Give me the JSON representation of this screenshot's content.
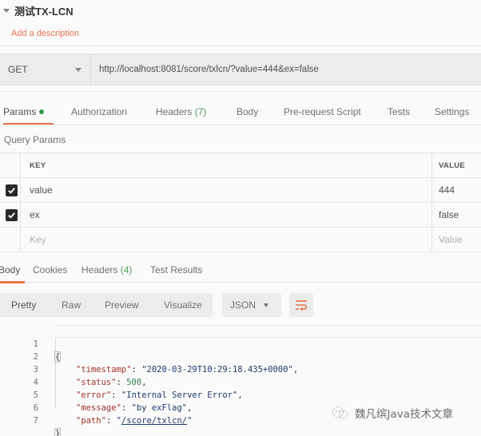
{
  "request": {
    "name": "测试TX-LCN",
    "add_description": "Add a description",
    "method": "GET",
    "url": "http://localhost:8081/score/txlcn/?value=444&ex=false"
  },
  "request_tabs": [
    {
      "label": "Params",
      "active": true,
      "indicator": "green-dot"
    },
    {
      "label": "Authorization"
    },
    {
      "label": "Headers",
      "count": "(7)"
    },
    {
      "label": "Body"
    },
    {
      "label": "Pre-request Script"
    },
    {
      "label": "Tests"
    },
    {
      "label": "Settings"
    }
  ],
  "query_params": {
    "title": "Query Params",
    "headers": {
      "key": "KEY",
      "value": "VALUE"
    },
    "rows": [
      {
        "checked": true,
        "key": "value",
        "value": "444"
      },
      {
        "checked": true,
        "key": "ex",
        "value": "false"
      }
    ],
    "new_row": {
      "key_placeholder": "Key",
      "value_placeholder": "Value"
    }
  },
  "response_tabs": [
    {
      "label": "Body",
      "active": true
    },
    {
      "label": "Cookies"
    },
    {
      "label": "Headers",
      "count": "(4)"
    },
    {
      "label": "Test Results"
    }
  ],
  "response_toolbar": {
    "views": [
      "Pretty",
      "Raw",
      "Preview",
      "Visualize"
    ],
    "active_view": "Pretty",
    "format": "JSON",
    "wrap_icon": "wrap-lines-icon"
  },
  "response_body": {
    "line_numbers": [
      "1",
      "2",
      "3",
      "4",
      "5",
      "6",
      "7"
    ],
    "open_brace": "{",
    "close_brace": "}",
    "fields": [
      {
        "key": "\"timestamp\"",
        "value": "\"2020-03-29T10:29:18.435+0000\"",
        "type": "string",
        "comma": true
      },
      {
        "key": "\"status\"",
        "value": "500",
        "type": "number",
        "comma": true
      },
      {
        "key": "\"error\"",
        "value": "\"Internal Server Error\"",
        "type": "string",
        "comma": true
      },
      {
        "key": "\"message\"",
        "value": "\"by exFlag\"",
        "type": "string",
        "comma": true
      },
      {
        "key": "\"path\"",
        "value": "/score/txlcn/",
        "type": "link",
        "comma": false
      }
    ]
  },
  "watermark": {
    "text": "魏凡缤Java技术文章"
  },
  "colors": {
    "accent": "#e8724a",
    "success": "#2e9b48",
    "json_key": "#a3332b",
    "json_string": "#1f3a6d",
    "json_number": "#2f7f4e"
  }
}
